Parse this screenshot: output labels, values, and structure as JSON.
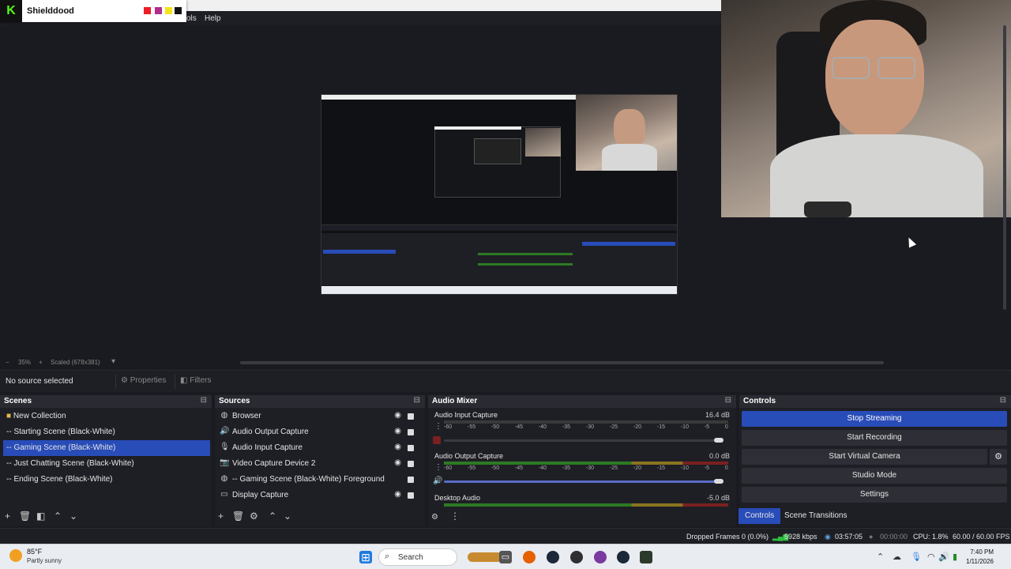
{
  "kick": {
    "logo": "K",
    "channel": "Shielddood",
    "swatches": [
      "#ee1c25",
      "#b12d8e",
      "#f5e31a",
      "#111111"
    ]
  },
  "menu": {
    "tools": "ols",
    "help": "Help"
  },
  "zoom": {
    "minus": "−",
    "percent": "35%",
    "plus": "+",
    "scaled": "Scaled (678x381)",
    "dropdown": "▾"
  },
  "context": {
    "no_source": "No source selected",
    "properties": "Properties",
    "filters": "Filters"
  },
  "scenes": {
    "title": "Scenes",
    "items": [
      {
        "label": "New Collection"
      },
      {
        "label": "-- Starting Scene (Black-White)"
      },
      {
        "label": "-- Gaming Scene (Black-White)"
      },
      {
        "label": "-- Just Chatting Scene (Black-White)"
      },
      {
        "label": "-- Ending Scene (Black-White)"
      }
    ],
    "selected_index": 2
  },
  "sources": {
    "title": "Sources",
    "items": [
      {
        "label": "Browser",
        "icon": "globe-icon"
      },
      {
        "label": "Audio Output Capture",
        "icon": "speaker-icon"
      },
      {
        "label": "Audio Input Capture",
        "icon": "microphone-icon"
      },
      {
        "label": "Video Capture Device 2",
        "icon": "camera-icon"
      },
      {
        "label": "-- Gaming Scene (Black-White)  Foreground Browse",
        "icon": "globe-icon"
      },
      {
        "label": "Display Capture",
        "icon": "monitor-icon"
      }
    ]
  },
  "mixer": {
    "title": "Audio Mixer",
    "ticks": [
      "-60",
      "-55",
      "-50",
      "-45",
      "-40",
      "-35",
      "-30",
      "-25",
      "-20",
      "-15",
      "-10",
      "-5",
      "0"
    ],
    "channels": [
      {
        "name": "Audio Input Capture",
        "db": "16.4 dB"
      },
      {
        "name": "Audio Output Capture",
        "db": "0.0 dB"
      },
      {
        "name": "Desktop Audio",
        "db": "-5.0 dB"
      }
    ]
  },
  "controls": {
    "title": "Controls",
    "stop_streaming": "Stop Streaming",
    "start_recording": "Start Recording",
    "start_virtual_camera": "Start Virtual Camera",
    "studio_mode": "Studio Mode",
    "settings": "Settings",
    "tab_controls": "Controls",
    "tab_transitions": "Scene Transitions"
  },
  "status": {
    "dropped_frames": "Dropped Frames 0 (0.0%)",
    "bitrate": "5928 kbps",
    "stream_time": "03:57:05",
    "rec_time": "00:00:00",
    "cpu": "CPU: 1.8%",
    "fps": "60.00 / 60.00 FPS"
  },
  "taskbar": {
    "temp": "85°F",
    "weather": "Partly sunny",
    "search": "Search",
    "time": "7:40 PM",
    "date": "1/11/2026"
  }
}
